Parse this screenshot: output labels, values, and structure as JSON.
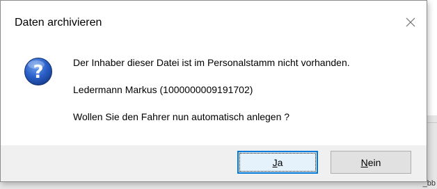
{
  "dialog": {
    "title": "Daten archivieren",
    "close_icon": "close-icon",
    "icon": "question-icon",
    "message_line1": "Der Inhaber dieser Datei ist im Personalstamm nicht vorhanden.",
    "message_line2": "Ledermann Markus (1000000009191702)",
    "message_line3": "Wollen Sie den Fahrer nun automatisch anlegen ?",
    "buttons": {
      "yes": {
        "mnemonic": "J",
        "rest": "a"
      },
      "no": {
        "mnemonic": "N",
        "rest": "ein"
      }
    }
  },
  "background": {
    "corner_text": "_bb"
  },
  "colors": {
    "accent": "#0078d7",
    "icon_blue": "#1b55c0"
  }
}
